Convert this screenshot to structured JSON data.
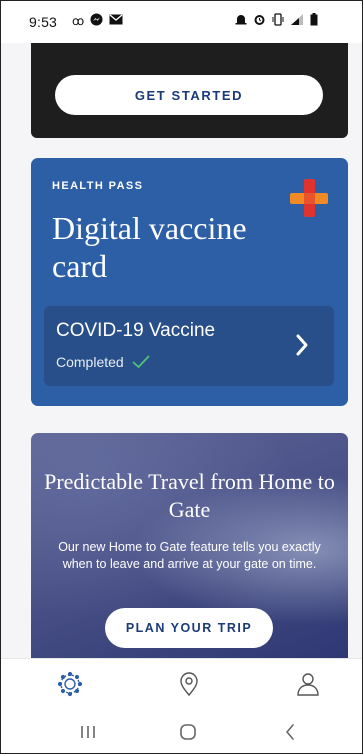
{
  "status_bar": {
    "time": "9:53",
    "left_icons": [
      "voicemail-icon",
      "messenger-icon",
      "email-icon"
    ],
    "right_icons": [
      "alarm-icon",
      "alarm-clock-icon",
      "vibrate-icon",
      "signal-icon",
      "battery-icon"
    ]
  },
  "top_card": {
    "button_label": "GET STARTED"
  },
  "health_pass": {
    "label": "HEALTH PASS",
    "title": "Digital vaccine card",
    "vaccine_name": "COVID-19 Vaccine",
    "status": "Completed",
    "colors": {
      "card": "#2d5fa6",
      "row": "#284f8a",
      "check": "#4fc37a",
      "plus_top": "#e0332f",
      "plus_side": "#f08a24"
    }
  },
  "promo": {
    "title": "Predictable Travel from Home to Gate",
    "body": "Our new Home to Gate feature tells you exactly when to leave and arrive at your gate on time.",
    "button_label": "PLAN YOUR TRIP"
  },
  "tab_bar": {
    "items": [
      "home-icon",
      "location-pin-icon",
      "profile-icon"
    ]
  },
  "nav_bar": {
    "items": [
      "recents-icon",
      "home-circle-icon",
      "back-icon"
    ]
  }
}
